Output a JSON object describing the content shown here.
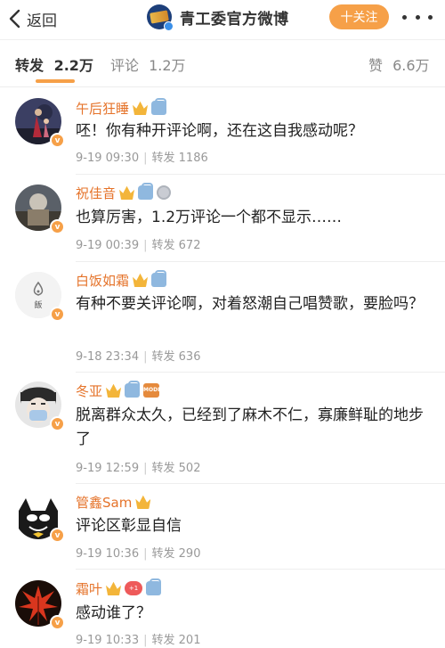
{
  "header": {
    "back_label": "返回",
    "title": "青工委官方微博",
    "follow_label": "十关注"
  },
  "tabs": [
    {
      "label": "转发",
      "count": "2.2万"
    },
    {
      "label": "评论",
      "count": "1.2万"
    },
    {
      "label": "赞",
      "count": "6.6万"
    }
  ],
  "colors": {
    "accent": "#f6a048",
    "username": "#e5732a",
    "verified": "#f6a048"
  },
  "comments": [
    {
      "username": "午后狂睡",
      "badges": [
        "crown-badge",
        "bag-badge"
      ],
      "text": "呸！你有种开评论啊，还在这自我感动呢？",
      "date": "9-19 09:30",
      "repost_label": "转发",
      "repost_count": "1186"
    },
    {
      "username": "祝佳音",
      "badges": [
        "crown-badge",
        "bag-badge",
        "medal-badge"
      ],
      "text": "也算厉害，1.2万评论一个都不显示……",
      "date": "9-19 00:39",
      "repost_label": "转发",
      "repost_count": "672"
    },
    {
      "username": "白饭如霜",
      "badges": [
        "crown-badge",
        "bag-badge"
      ],
      "text": "有种不要关评论啊，对着怒潮自己唱赞歌，要脸吗？",
      "date": "9-18 23:34",
      "repost_label": "转发",
      "repost_count": "636"
    },
    {
      "username": "冬亚",
      "badges": [
        "crown-badge",
        "bag-badge",
        "mode-badge"
      ],
      "mode_badge_text": "MODE",
      "text": "脱离群众太久，已经到了麻木不仁，寡廉鲜耻的地步了",
      "date": "9-19 12:59",
      "repost_label": "转发",
      "repost_count": "502"
    },
    {
      "username": "管鑫Sam",
      "badges": [
        "crown-badge"
      ],
      "text": "评论区彰显自信",
      "date": "9-19 10:36",
      "repost_label": "转发",
      "repost_count": "290"
    },
    {
      "username": "霜叶",
      "badges": [
        "crown-badge",
        "heart-badge",
        "bag-badge"
      ],
      "heart_badge_text": "+1",
      "text": "感动谁了？",
      "date": "9-19 10:33",
      "repost_label": "转发",
      "repost_count": "201"
    }
  ]
}
